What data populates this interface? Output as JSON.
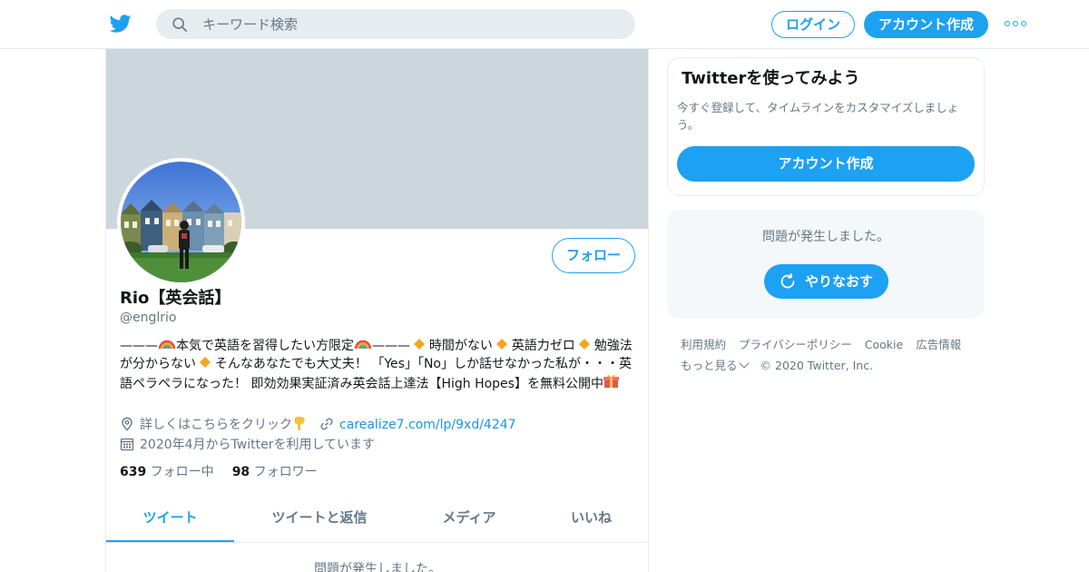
{
  "header": {
    "logo_icon": "twitter-bird-icon",
    "search_placeholder": "キーワード検索",
    "login_label": "ログイン",
    "signup_label": "アカウント作成",
    "more_icon": "more-dots-icon",
    "accent_color": "#1da1f2"
  },
  "profile": {
    "name": "Rio【英会話】",
    "handle": "@englrio",
    "follow_label": "フォロー",
    "bio": {
      "p1": "———",
      "p2": "本気で英語を習得したい方限定",
      "p3": "———  ",
      "p4": " 時間がない  ",
      "p5": " 英語力ゼロ ",
      "p6": " 勉強法が分からない ",
      "p7": "  そんなあなたでも大丈夫！ 「Yes」「No」しか話せなかった私が・・・英語ペラペラになった！ 即効効果実証済み英会話上達法【High Hopes】を無料公開中"
    },
    "location": "詳しくはこちらをクリック",
    "link": "carealize7.com/lp/9xd/4247",
    "joined": "2020年4月からTwitterを利用しています",
    "following_count": "639",
    "following_label": "フォロー中",
    "followers_count": "98",
    "followers_label": "フォロワー"
  },
  "tabs": [
    {
      "label": "ツイート"
    },
    {
      "label": "ツイートと返信"
    },
    {
      "label": "メディア"
    },
    {
      "label": "いいね"
    }
  ],
  "timeline_error": "問題が発生しました。",
  "signup_card": {
    "title": "Twitterを使ってみよう",
    "desc": "今すぐ登録して、タイムラインをカスタマイズしましょう。",
    "cta": "アカウント作成"
  },
  "error_card": {
    "message": "問題が発生しました。",
    "retry_label": "やりなおす"
  },
  "footer": {
    "terms": "利用規約",
    "privacy": "プライバシーポリシー",
    "cookie": "Cookie",
    "ads": "広告情報",
    "more": "もっと見る",
    "copyright": "© 2020 Twitter, Inc."
  }
}
